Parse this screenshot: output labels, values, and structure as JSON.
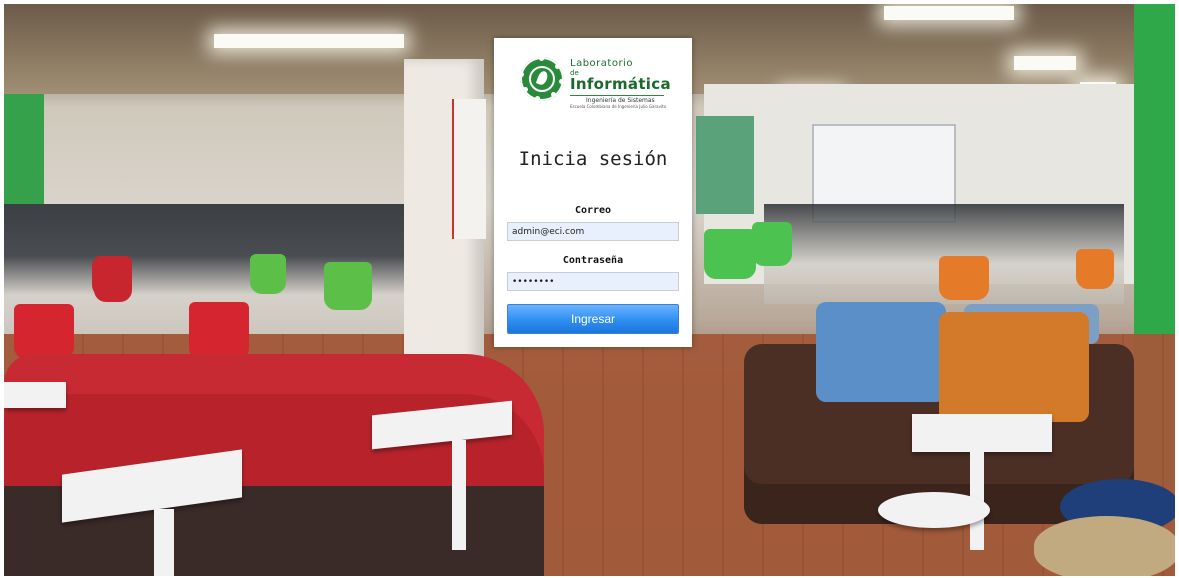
{
  "logo": {
    "line1": "Laboratorio",
    "line2": "de",
    "line3": "Informática",
    "line4": "Ingeniería de Sistemas",
    "line5": "Escuela Colombiana de Ingeniería Julio Garavito"
  },
  "login": {
    "title": "Inicia sesión",
    "email_label": "Correo",
    "email_value": "admin@eci.com",
    "password_label": "Contraseña",
    "password_value": "••••••••",
    "submit_label": "Ingresar"
  },
  "colors": {
    "brand_green": "#2a8a3c",
    "button_blue": "#2f8ef2",
    "input_bg": "#e8f0fe"
  }
}
